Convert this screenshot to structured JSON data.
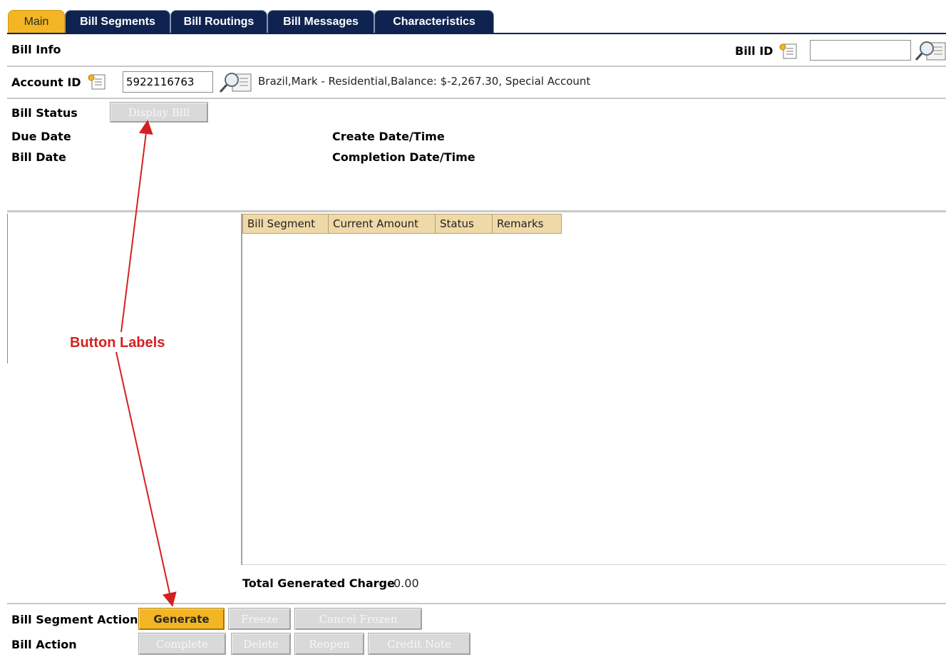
{
  "tabs": [
    "Main",
    "Bill Segments",
    "Bill Routings",
    "Bill Messages",
    "Characteristics"
  ],
  "bill_info": {
    "section_label": "Bill Info",
    "bill_id_label": "Bill ID",
    "bill_id_value": ""
  },
  "account": {
    "label": "Account ID",
    "value": "5922116763",
    "description": "Brazil,Mark - Residential,Balance: $-2,267.30, Special Account"
  },
  "details": {
    "bill_status_label": "Bill Status",
    "display_bill_button": "Display Bill",
    "due_date_label": "Due Date",
    "bill_date_label": "Bill Date",
    "create_label": "Create Date/Time",
    "completion_label": "Completion Date/Time"
  },
  "grid": {
    "columns": [
      "Bill Segment",
      "Current Amount",
      "Status",
      "Remarks"
    ]
  },
  "total": {
    "label": "Total Generated Charge",
    "value": "0.00"
  },
  "segment_action": {
    "label": "Bill Segment Action",
    "buttons": [
      "Generate",
      "Freeze",
      "Cancel Frozen"
    ]
  },
  "bill_action": {
    "label": "Bill Action",
    "buttons": [
      "Complete",
      "Delete",
      "Reopen",
      "Credit Note"
    ]
  },
  "annotation": {
    "text": "Button Labels",
    "color": "#d42020"
  },
  "colors": {
    "tab_bg": "#0f2350",
    "accent": "#f3b523",
    "grid_header": "#efd9a8"
  }
}
